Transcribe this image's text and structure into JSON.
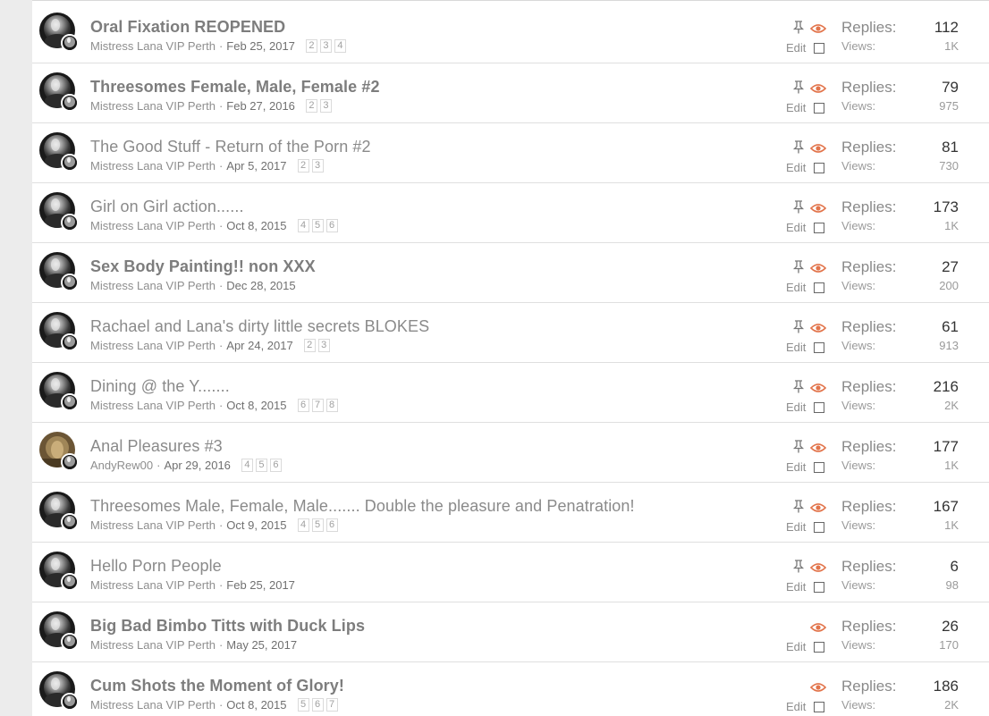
{
  "labels": {
    "replies": "Replies:",
    "views": "Views:",
    "edit": "Edit"
  },
  "colors": {
    "accent": "#e2744b",
    "text": "#8a8a8a",
    "divider": "#dfdfdf"
  },
  "threads": [
    {
      "title": "Oral Fixation REOPENED",
      "bold": true,
      "author": "Mistress Lana VIP Perth",
      "date": "Feb 25, 2017",
      "pages": [
        "2",
        "3",
        "4"
      ],
      "pinned": true,
      "replies": "112",
      "views": "1K",
      "avatar": "mono"
    },
    {
      "title": "Threesomes Female, Male, Female #2",
      "bold": true,
      "author": "Mistress Lana VIP Perth",
      "date": "Feb 27, 2016",
      "pages": [
        "2",
        "3"
      ],
      "pinned": true,
      "replies": "79",
      "views": "975",
      "avatar": "mono"
    },
    {
      "title": "The Good Stuff - Return of the Porn #2",
      "bold": false,
      "author": "Mistress Lana VIP Perth",
      "date": "Apr 5, 2017",
      "pages": [
        "2",
        "3"
      ],
      "pinned": true,
      "replies": "81",
      "views": "730",
      "avatar": "mono"
    },
    {
      "title": "Girl on Girl action......",
      "bold": false,
      "author": "Mistress Lana VIP Perth",
      "date": "Oct 8, 2015",
      "pages": [
        "4",
        "5",
        "6"
      ],
      "pinned": true,
      "replies": "173",
      "views": "1K",
      "avatar": "mono"
    },
    {
      "title": "Sex Body Painting!! non XXX",
      "bold": true,
      "author": "Mistress Lana VIP Perth",
      "date": "Dec 28, 2015",
      "pages": [],
      "pinned": true,
      "replies": "27",
      "views": "200",
      "avatar": "mono"
    },
    {
      "title": "Rachael and Lana's dirty little secrets BLOKES",
      "bold": false,
      "author": "Mistress Lana VIP Perth",
      "date": "Apr 24, 2017",
      "pages": [
        "2",
        "3"
      ],
      "pinned": true,
      "replies": "61",
      "views": "913",
      "avatar": "mono"
    },
    {
      "title": "Dining @ the Y.......",
      "bold": false,
      "author": "Mistress Lana VIP Perth",
      "date": "Oct 8, 2015",
      "pages": [
        "6",
        "7",
        "8"
      ],
      "pinned": true,
      "replies": "216",
      "views": "2K",
      "avatar": "mono"
    },
    {
      "title": "Anal Pleasures #3",
      "bold": false,
      "author": "AndyRew00",
      "date": "Apr 29, 2016",
      "pages": [
        "4",
        "5",
        "6"
      ],
      "pinned": true,
      "replies": "177",
      "views": "1K",
      "avatar": "sepia"
    },
    {
      "title": "Threesomes Male, Female, Male....... Double the pleasure and Penatration!",
      "bold": false,
      "author": "Mistress Lana VIP Perth",
      "date": "Oct 9, 2015",
      "pages": [
        "4",
        "5",
        "6"
      ],
      "pinned": true,
      "replies": "167",
      "views": "1K",
      "avatar": "mono"
    },
    {
      "title": "Hello Porn People",
      "bold": false,
      "author": "Mistress Lana VIP Perth",
      "date": "Feb 25, 2017",
      "pages": [],
      "pinned": true,
      "replies": "6",
      "views": "98",
      "avatar": "mono"
    },
    {
      "title": "Big Bad Bimbo Titts with Duck Lips",
      "bold": true,
      "author": "Mistress Lana VIP Perth",
      "date": "May 25, 2017",
      "pages": [],
      "pinned": false,
      "replies": "26",
      "views": "170",
      "avatar": "mono"
    },
    {
      "title": "Cum Shots the Moment of Glory!",
      "bold": true,
      "author": "Mistress Lana VIP Perth",
      "date": "Oct 8, 2015",
      "pages": [
        "5",
        "6",
        "7"
      ],
      "pinned": false,
      "replies": "186",
      "views": "2K",
      "avatar": "mono"
    }
  ]
}
